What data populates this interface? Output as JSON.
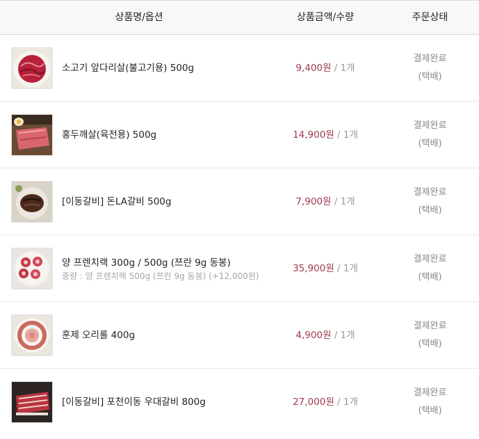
{
  "header": {
    "name_label": "상품명/옵션",
    "price_label": "상품금액/수량",
    "status_label": "주문상태"
  },
  "items": [
    {
      "name": "소고기 앞다리살(불고기용) 500g",
      "option": "",
      "price": "9,400원",
      "qty": "/ 1개",
      "status": "결제완료",
      "delivery": "(택배)",
      "image": "sliced-beef"
    },
    {
      "name": "홍두깨살(육전용) 500g",
      "option": "",
      "price": "14,900원",
      "qty": "/ 1개",
      "status": "결제완료",
      "delivery": "(택배)",
      "image": "beef-slices"
    },
    {
      "name": "[이동갈비] 돈LA갈비 500g",
      "option": "",
      "price": "7,900원",
      "qty": "/ 1개",
      "status": "결제완료",
      "delivery": "(택배)",
      "image": "grilled-ribs"
    },
    {
      "name": "양 프렌치랙 300g / 500g (쯔란 9g 동봉)",
      "option": "중량 : 양 프렌치랙 500g (쯔란 9g 동봉) (+12,000원)",
      "price": "35,900원",
      "qty": "/ 1개",
      "status": "결제완료",
      "delivery": "(택배)",
      "image": "lamb-rack"
    },
    {
      "name": "훈제 오리롤 400g",
      "option": "",
      "price": "4,900원",
      "qty": "/ 1개",
      "status": "결제완료",
      "delivery": "(택배)",
      "image": "duck-roll"
    },
    {
      "name": "[이동갈비] 포천이동 우대갈비 800g",
      "option": "",
      "price": "27,000원",
      "qty": "/ 1개",
      "status": "결제완료",
      "delivery": "(택배)",
      "image": "beef-ribs"
    }
  ],
  "colors": {
    "price": "#9b3a4a",
    "muted": "#9a9a9a",
    "header_bg": "#f8f8f8"
  }
}
